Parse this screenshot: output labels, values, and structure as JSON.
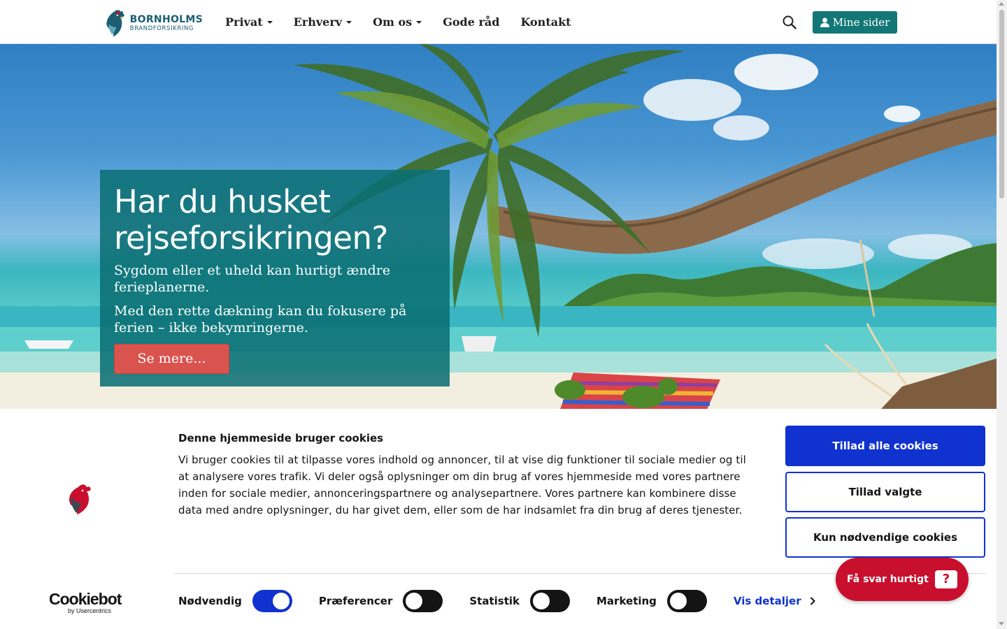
{
  "header": {
    "logo": {
      "line1": "BORNHOLMS",
      "line2": "BRANDFORSIKRING",
      "icon": "rooster-logo-icon"
    },
    "nav": [
      {
        "label": "Privat",
        "dropdown": true
      },
      {
        "label": "Erhverv",
        "dropdown": true
      },
      {
        "label": "Om os",
        "dropdown": true
      },
      {
        "label": "Gode råd",
        "dropdown": false
      },
      {
        "label": "Kontakt",
        "dropdown": false
      }
    ],
    "search_icon": "search-icon",
    "mine_sider_label": "Mine sider",
    "accent_color": "#127776"
  },
  "hero": {
    "title": "Har du husket rejseforsikringen?",
    "text1": "Sygdom eller et uheld kan hurtigt ændre ferieplanerne.",
    "text2": "Med den rette dækning kan du fokusere på ferien – ikke bekymringerne.",
    "button_label": "Se mere...",
    "button_color": "#d9534f"
  },
  "cookie": {
    "heading": "Denne hjemmeside bruger cookies",
    "body": "Vi bruger cookies til at tilpasse vores indhold og annoncer, til at vise dig funktioner til sociale medier og til at analysere vores trafik. Vi deler også oplysninger om din brug af vores hjemmeside med vores partnere inden for sociale medier, annonceringspartnere og analysepartnere. Vores partnere kan kombinere disse data med andre oplysninger, du har givet dem, eller som de har indsamlet fra din brug af deres tjenester.",
    "buttons": {
      "allow_all": "Tillad alle cookies",
      "allow_selected": "Tillad valgte",
      "only_necessary": "Kun nødvendige cookies"
    },
    "brand": {
      "main": "Cookiebot",
      "sub": "by Usercentrics"
    },
    "toggles": [
      {
        "label": "Nødvendig",
        "on": true
      },
      {
        "label": "Præferencer",
        "on": false
      },
      {
        "label": "Statistik",
        "on": false
      },
      {
        "label": "Marketing",
        "on": false
      }
    ],
    "details_label": "Vis detaljer",
    "accent_color": "#1032cf"
  },
  "chat": {
    "label": "Få svar hurtigt",
    "bubble": "?",
    "color": "#c8102e"
  }
}
